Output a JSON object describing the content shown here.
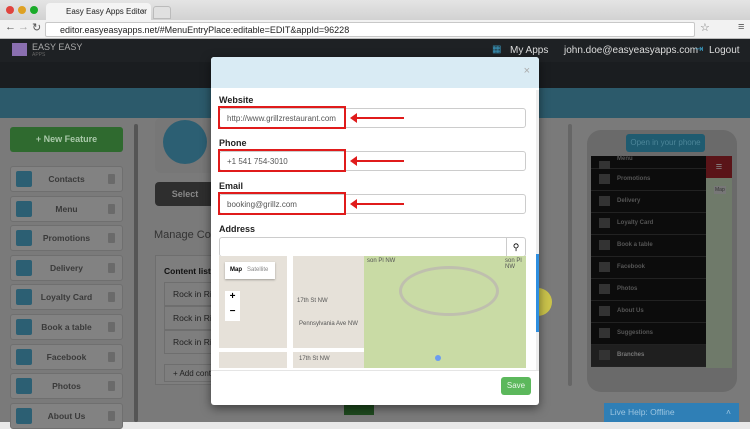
{
  "browser": {
    "tab_title": "Easy Easy Apps Editor",
    "url": "editor.easyeasyapps.net/#MenuEntryPlace:editable=EDIT&appId=96228"
  },
  "header": {
    "logo": "EASY EASY",
    "logo_sub": "APPS",
    "my_apps": "My Apps",
    "user": "john.doe@easyeasyapps.com",
    "logout": "Logout"
  },
  "sidebar": {
    "new_feature": "+ New Feature",
    "items": [
      {
        "label": "Contacts"
      },
      {
        "label": "Menu"
      },
      {
        "label": "Promotions"
      },
      {
        "label": "Delivery"
      },
      {
        "label": "Loyalty Card"
      },
      {
        "label": "Book a table"
      },
      {
        "label": "Facebook"
      },
      {
        "label": "Photos"
      },
      {
        "label": "About Us"
      }
    ]
  },
  "center": {
    "select": "Select",
    "manage": "Manage Co",
    "content_list": "Content list",
    "rows": [
      "Rock in Ri",
      "Rock in Ri",
      "Rock in Ri"
    ],
    "add_content": "+ Add conte"
  },
  "modal": {
    "close": "×",
    "website_label": "Website",
    "website_value": "http://www.grillzrestaurant.com",
    "phone_label": "Phone",
    "phone_value": "+1 541 754-3010",
    "email_label": "Email",
    "email_value": "booking@grillz.com",
    "address_label": "Address",
    "address_value": "",
    "map_tab": "Map",
    "satellite_tab": "Satellite",
    "zoom_in": "+",
    "zoom_out": "−",
    "streets": [
      "17th St NW",
      "Pennsylvania Ave NW",
      "17th St NW",
      "son Pl NW",
      "son Pl NW"
    ],
    "save": "Save"
  },
  "preview": {
    "open_phone": "Open in your phone",
    "menu": [
      "Menu",
      "Promotions",
      "Delivery",
      "Loyalty Card",
      "Book a table",
      "Facebook",
      "Photos",
      "About Us",
      "Suggestions",
      "Branches"
    ],
    "map_btn": "Map"
  },
  "live_help": "Live Help: Offline"
}
